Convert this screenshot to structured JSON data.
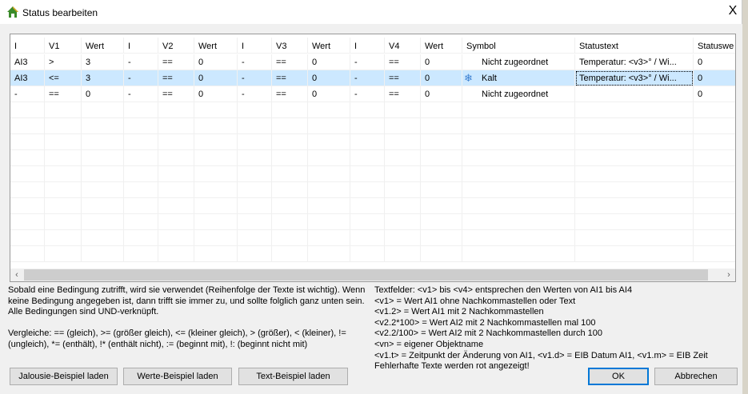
{
  "window": {
    "title": "Status bearbeiten",
    "close": "X"
  },
  "table": {
    "headers": [
      "I",
      "V1",
      "Wert",
      "I",
      "V2",
      "Wert",
      "I",
      "V3",
      "Wert",
      "I",
      "V4",
      "Wert",
      "Symbol",
      "Statustext",
      "Statuswe"
    ],
    "rows": [
      [
        "AI3",
        ">",
        "3",
        "-",
        "==",
        "0",
        "-",
        "==",
        "0",
        "-",
        "==",
        "0",
        "Nicht zugeordnet",
        "Temperatur: <v3>° / Wi...",
        "0"
      ],
      [
        "AI3",
        "<=",
        "3",
        "-",
        "==",
        "0",
        "-",
        "==",
        "0",
        "-",
        "==",
        "0",
        "Kalt",
        "Temperatur: <v3>° / Wi...",
        "0"
      ],
      [
        "-",
        "==",
        "0",
        "-",
        "==",
        "0",
        "-",
        "==",
        "0",
        "-",
        "==",
        "0",
        "Nicht zugeordnet",
        "",
        "0"
      ]
    ],
    "selected_row": 1
  },
  "help_left": [
    "Sobald eine Bedingung zutrifft, wird sie verwendet (Reihenfolge der Texte ist wichtig). Wenn",
    "keine Bedingung angegeben ist, dann trifft sie immer zu, und sollte folglich ganz unten sein.",
    "Alle Bedingungen sind UND-verknüpft.",
    "",
    "Vergleiche: == (gleich), >= (größer gleich), <= (kleiner gleich), > (größer), < (kleiner), !=",
    "(ungleich), *= (enthält), !* (enthält nicht), := (beginnt mit), !: (beginnt nicht mit)"
  ],
  "help_right": [
    "Textfelder: <v1> bis <v4> entsprechen den Werten von AI1 bis AI4",
    "<v1> = Wert AI1 ohne Nachkommastellen oder Text",
    "<v1.2> = Wert AI1 mit 2 Nachkommastellen",
    "<v2.2*100> = Wert AI2 mit 2 Nachkommastellen mal 100",
    "<v2.2/100> = Wert AI2 mit 2 Nachkommastellen durch 100",
    "<vn> = eigener Objektname",
    "<v1.t> = Zeitpunkt der Änderung von AI1, <v1.d> = EIB Datum AI1, <v1.m> = EIB Zeit",
    "Fehlerhafte Texte werden rot angezeigt!"
  ],
  "buttons": {
    "jalousie": "Jalousie-Beispiel laden",
    "werte": "Werte-Beispiel laden",
    "text": "Text-Beispiel laden",
    "ok": "OK",
    "cancel": "Abbrechen"
  }
}
